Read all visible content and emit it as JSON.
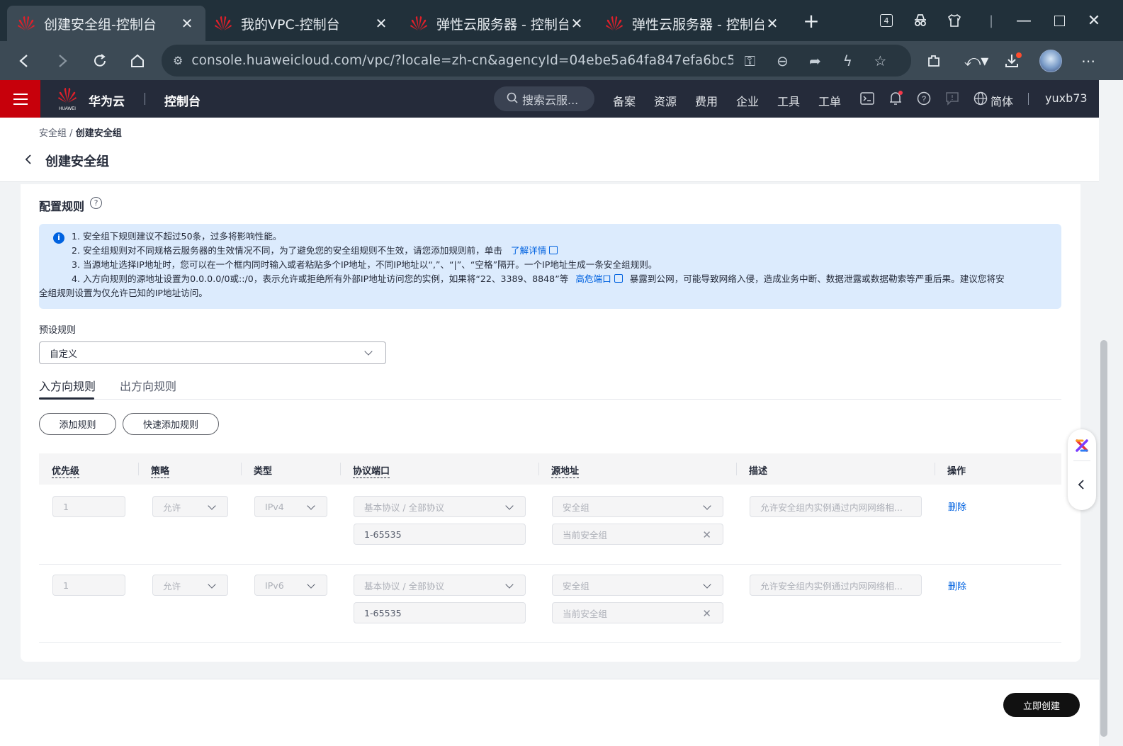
{
  "browser": {
    "tabs": [
      {
        "title": "创建安全组-控制台",
        "active": true
      },
      {
        "title": "我的VPC-控制台",
        "active": false
      },
      {
        "title": "弹性云服务器 - 控制台",
        "active": false
      },
      {
        "title": "弹性云服务器 - 控制台",
        "active": false
      }
    ],
    "tab_count": "4",
    "url": "console.huaweicloud.com/vpc/?locale=zh-cn&agencyId=04ebe5a64fa847efa6bc54f919..."
  },
  "header": {
    "brand": "华为云",
    "console": "控制台",
    "search_placeholder": "搜索云服...",
    "nav": [
      "备案",
      "资源",
      "费用",
      "企业",
      "工具",
      "工单"
    ],
    "language": "简体",
    "user": "yuxb73"
  },
  "breadcrumb": {
    "parent": "安全组",
    "sep": "/",
    "current": "创建安全组"
  },
  "page_title": "创建安全组",
  "section_title": "配置规则",
  "notice": {
    "line1": "1. 安全组下规则建议不超过50条，过多将影响性能。",
    "line2": "2. 安全组规则对不同规格云服务器的生效情况不同，为了避免您的安全组规则不生效，请您添加规则前，单击",
    "line2_link": "了解详情",
    "line3": "3. 当源地址选择IP地址时，您可以在一个框内同时输入或者粘贴多个IP地址，不同IP地址以“,”、“|”、“空格”隔开。一个IP地址生成一条安全组规则。",
    "line4a": "4. 入方向规则的源地址设置为0.0.0.0/0或::/0，表示允许或拒绝所有外部IP地址访问您的实例，如果将“22、3389、8848”等",
    "line4_link": "高危端口",
    "line4b": "暴露到公网，可能导致网络入侵，造成业务中断、数据泄露或数据勒索等严重后果。建议您将安",
    "line5": "全组规则设置为仅允许已知的IP地址访问。"
  },
  "preset": {
    "label": "预设规则",
    "value": "自定义"
  },
  "direction_tabs": {
    "inbound": "入方向规则",
    "outbound": "出方向规则"
  },
  "buttons": {
    "add_rule": "添加规则",
    "quick_add": "快速添加规则",
    "create": "立即创建"
  },
  "table": {
    "headers": [
      "优先级",
      "策略",
      "类型",
      "协议端口",
      "源地址",
      "描述",
      "操作"
    ],
    "rows": [
      {
        "priority": "1",
        "policy": "允许",
        "type": "IPv4",
        "protocol": "基本协议 / 全部协议",
        "port": "1-65535",
        "source_type": "安全组",
        "source": "当前安全组",
        "description": "允许安全组内实例通过内网网络相...",
        "action": "删除"
      },
      {
        "priority": "1",
        "policy": "允许",
        "type": "IPv6",
        "protocol": "基本协议 / 全部协议",
        "port": "1-65535",
        "source_type": "安全组",
        "source": "当前安全组",
        "description": "允许安全组内实例通过内网网络相...",
        "action": "删除"
      }
    ]
  },
  "colors": {
    "brand_red": "#c7000b",
    "header_bg": "#252b3a",
    "link": "#0062e0",
    "notice_bg": "#dcebfd"
  }
}
